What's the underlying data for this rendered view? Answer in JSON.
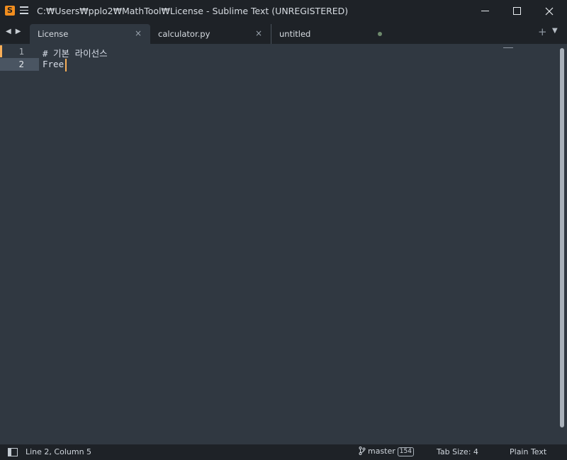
{
  "window": {
    "title": "C:₩Users₩pplo2₩MathTool₩License - Sublime Text (UNREGISTERED)",
    "app_icon_letter": "S"
  },
  "tabs": [
    {
      "label": "License",
      "close": "×",
      "active": true
    },
    {
      "label": "calculator.py",
      "close": "×",
      "active": false
    },
    {
      "label": "untitled",
      "dirty": true,
      "active": false
    }
  ],
  "tabbar": {
    "add_label": "+",
    "menu_label": "▼",
    "back_arrow": "◀",
    "forward_arrow": "▶"
  },
  "editor": {
    "lines": [
      {
        "number": "1",
        "text": "# 기본 라이선스"
      },
      {
        "number": "2",
        "text": "Free"
      }
    ]
  },
  "statusbar": {
    "position": "Line 2, Column 5",
    "branch": "master",
    "branch_badge": "154",
    "tab_size": "Tab Size: 4",
    "syntax": "Plain Text"
  },
  "colors": {
    "accent": "#f9ae58",
    "background": "#303841",
    "chrome": "#1e2227"
  }
}
